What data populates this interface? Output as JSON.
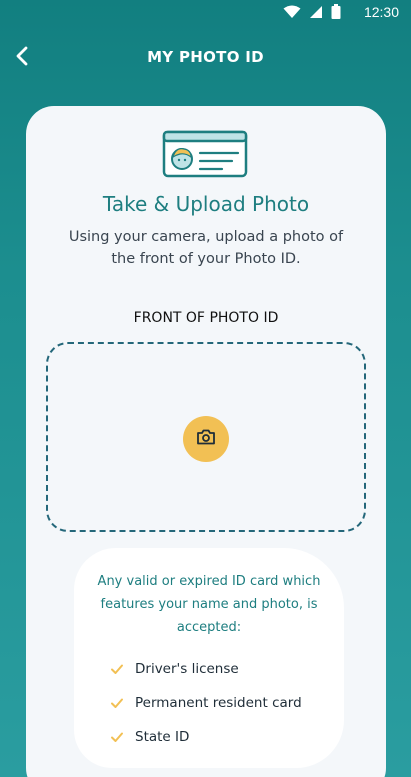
{
  "status_bar": {
    "time": "12:30",
    "icons": [
      "wifi-icon",
      "signal-icon",
      "battery-icon"
    ]
  },
  "app_bar": {
    "title": "MY PHOTO ID",
    "back_icon": "chevron-left-icon"
  },
  "main": {
    "heading": "Take & Upload Photo",
    "subtext": "Using your camera, upload a photo of the front of your Photo ID.",
    "section_label": "FRONT OF PHOTO ID",
    "camera_icon": "camera-icon",
    "info": {
      "text": "Any valid or expired ID card which features your name and photo, is accepted:",
      "items": [
        {
          "label": "Driver's license"
        },
        {
          "label": "Permanent resident card"
        },
        {
          "label": "State ID"
        }
      ]
    }
  },
  "colors": {
    "background": "#1c8e8f",
    "teal_text": "#1e7e80",
    "accent_yellow": "#f2c054",
    "card_bg": "#f4f7fa",
    "dashed_border": "#24677a"
  }
}
